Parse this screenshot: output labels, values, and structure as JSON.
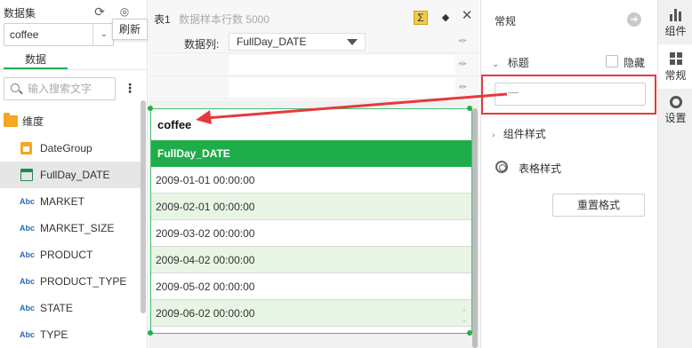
{
  "left_panel": {
    "title": "数据集",
    "tooltip": "刷新",
    "dataset_value": "coffee",
    "tab_label": "数据",
    "search_placeholder": "输入搜索文字",
    "dimension_label": "维度",
    "items": [
      {
        "label": "DateGroup",
        "type": "group"
      },
      {
        "label": "FullDay_DATE",
        "type": "date"
      },
      {
        "label": "MARKET",
        "type": "abc"
      },
      {
        "label": "MARKET_SIZE",
        "type": "abc"
      },
      {
        "label": "PRODUCT",
        "type": "abc"
      },
      {
        "label": "PRODUCT_TYPE",
        "type": "abc"
      },
      {
        "label": "STATE",
        "type": "abc"
      },
      {
        "label": "TYPE",
        "type": "abc"
      }
    ],
    "abc_badge": "Abc"
  },
  "editor": {
    "table_name": "表1",
    "sample_rows": "数据样本行数 5000",
    "sigma": "Σ",
    "data_col_label": "数据列:",
    "data_col_value": "FullDay_DATE",
    "component_title": "coffee",
    "table_header": "FullDay_DATE",
    "rows": [
      "2009-01-01 00:00:00",
      "2009-02-01 00:00:00",
      "2009-03-02 00:00:00",
      "2009-04-02 00:00:00",
      "2009-05-02 00:00:00",
      "2009-06-02 00:00:00"
    ]
  },
  "properties": {
    "title": "常规",
    "section_title": "标题",
    "hide_label": "隐藏",
    "title_input_value": "",
    "component_style": "组件样式",
    "table_style": "表格样式",
    "reset_button": "重置格式"
  },
  "side_tabs": [
    {
      "label": "组件",
      "icon": "bar-chart-icon"
    },
    {
      "label": "常规",
      "icon": "grid-icon"
    },
    {
      "label": "设置",
      "icon": "gear-icon"
    }
  ],
  "colors": {
    "accent": "#1fad4a",
    "alt_row": "#e8f5e4",
    "annotation": "#e8383d"
  }
}
